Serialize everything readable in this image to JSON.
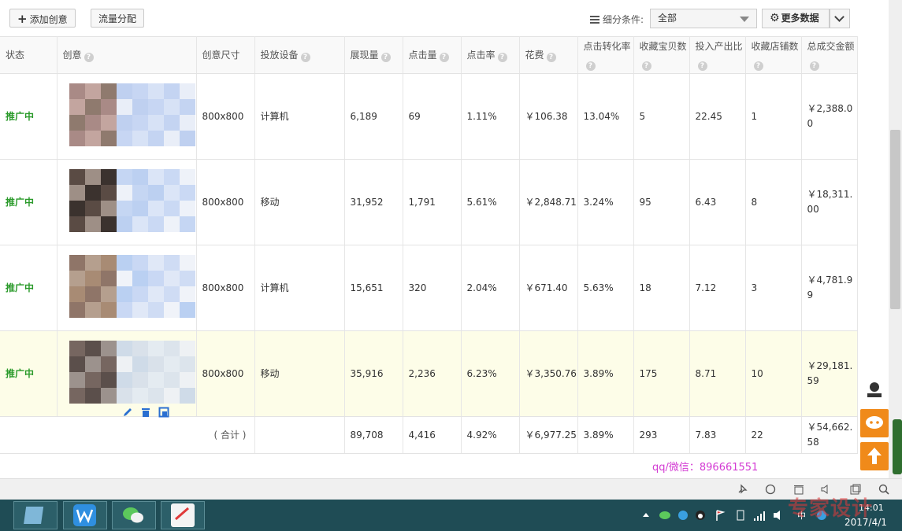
{
  "toolbar": {
    "add_creative": "添加创意",
    "traffic_allocation": "流量分配",
    "filter_label": "细分条件:",
    "filter_value": "全部",
    "more_data": "更多数据"
  },
  "columns": [
    "状态",
    "创意",
    "创意尺寸",
    "投放设备",
    "展现量",
    "点击量",
    "点击率",
    "花费",
    "点击转化率",
    "收藏宝贝数",
    "投入产出比",
    "收藏店铺数",
    "总成交金额"
  ],
  "rows": [
    {
      "status": "推广中",
      "size": "800x800",
      "device": "计算机",
      "impressions": "6,189",
      "clicks": "69",
      "ctr": "1.11%",
      "cost": "￥106.38",
      "cvr": "13.04%",
      "fav_items": "5",
      "roi": "22.45",
      "fav_shops": "1",
      "gmv": "￥2,388.00"
    },
    {
      "status": "推广中",
      "size": "800x800",
      "device": "移动",
      "impressions": "31,952",
      "clicks": "1,791",
      "ctr": "5.61%",
      "cost": "￥2,848.71",
      "cvr": "3.24%",
      "fav_items": "95",
      "roi": "6.43",
      "fav_shops": "8",
      "gmv": "￥18,311.00"
    },
    {
      "status": "推广中",
      "size": "800x800",
      "device": "计算机",
      "impressions": "15,651",
      "clicks": "320",
      "ctr": "2.04%",
      "cost": "￥671.40",
      "cvr": "5.63%",
      "fav_items": "18",
      "roi": "7.12",
      "fav_shops": "3",
      "gmv": "￥4,781.99"
    },
    {
      "status": "推广中",
      "size": "800x800",
      "device": "移动",
      "impressions": "35,916",
      "clicks": "2,236",
      "ctr": "6.23%",
      "cost": "￥3,350.76",
      "cvr": "3.89%",
      "fav_items": "175",
      "roi": "8.71",
      "fav_shops": "10",
      "gmv": "￥29,181.59"
    }
  ],
  "total": {
    "label": "( 合计 )",
    "impressions": "89,708",
    "clicks": "4,416",
    "ctr": "4.92%",
    "cost": "￥6,977.25",
    "cvr": "3.89%",
    "fav_items": "293",
    "roi": "7.83",
    "fav_shops": "22",
    "gmv": "￥54,662.58"
  },
  "contact": "qq/微信：896661551",
  "clock": {
    "time": "14:01",
    "date": "2017/4/1"
  },
  "watermark": "专家设计",
  "colors": {
    "status_green": "#2a9a2a",
    "contact_magenta": "#d33bd3",
    "highlight_row": "#fdfde8",
    "taskbar": "#1f4c55",
    "side_orange": "#f08a1a"
  }
}
